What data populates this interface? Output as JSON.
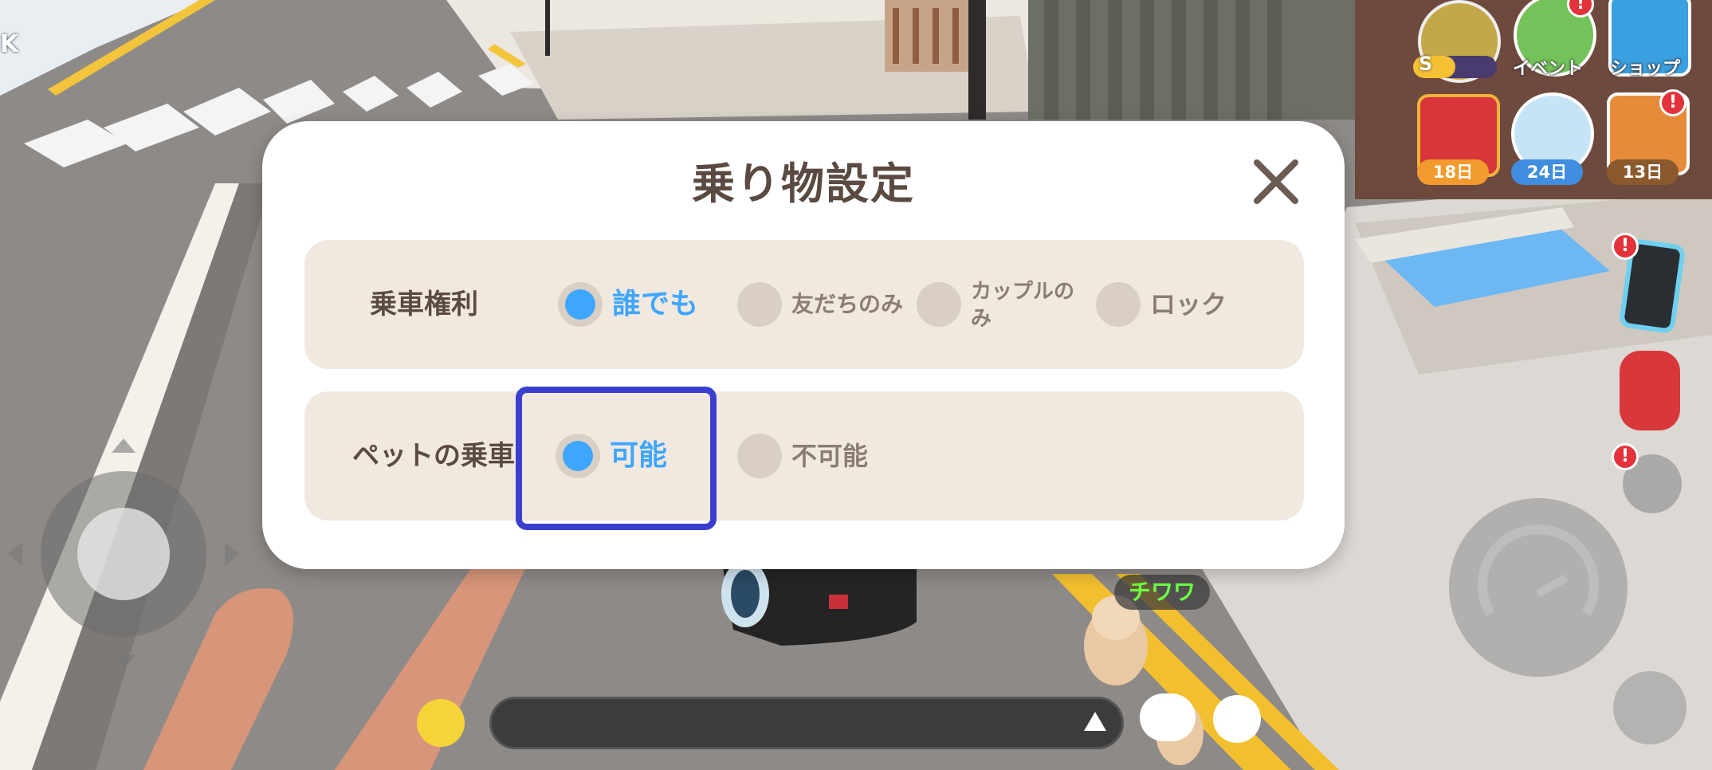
{
  "dialog": {
    "title": "乗り物設定",
    "rows": [
      {
        "label": "乗車権利",
        "options": [
          {
            "label": "誰でも",
            "selected": true
          },
          {
            "label": "友だちのみ",
            "selected": false
          },
          {
            "label": "カップルのみ",
            "selected": false
          },
          {
            "label": "ロック",
            "selected": false
          }
        ]
      },
      {
        "label": "ペットの乗車",
        "options": [
          {
            "label": "可能",
            "selected": true
          },
          {
            "label": "不可能",
            "selected": false
          }
        ]
      }
    ]
  },
  "hud": {
    "event_label": "イベント",
    "shop_label": "ショップ",
    "gift_days": "18日",
    "pet_days": "24日",
    "house_days": "13日",
    "level_badge": "S"
  },
  "npc_name": "チワワ",
  "corner_text": "K",
  "colors": {
    "accent": "#3fa6ff",
    "highlight_border": "#3a3fd0",
    "alert": "#e2333c",
    "npc_name": "#6dff45"
  }
}
